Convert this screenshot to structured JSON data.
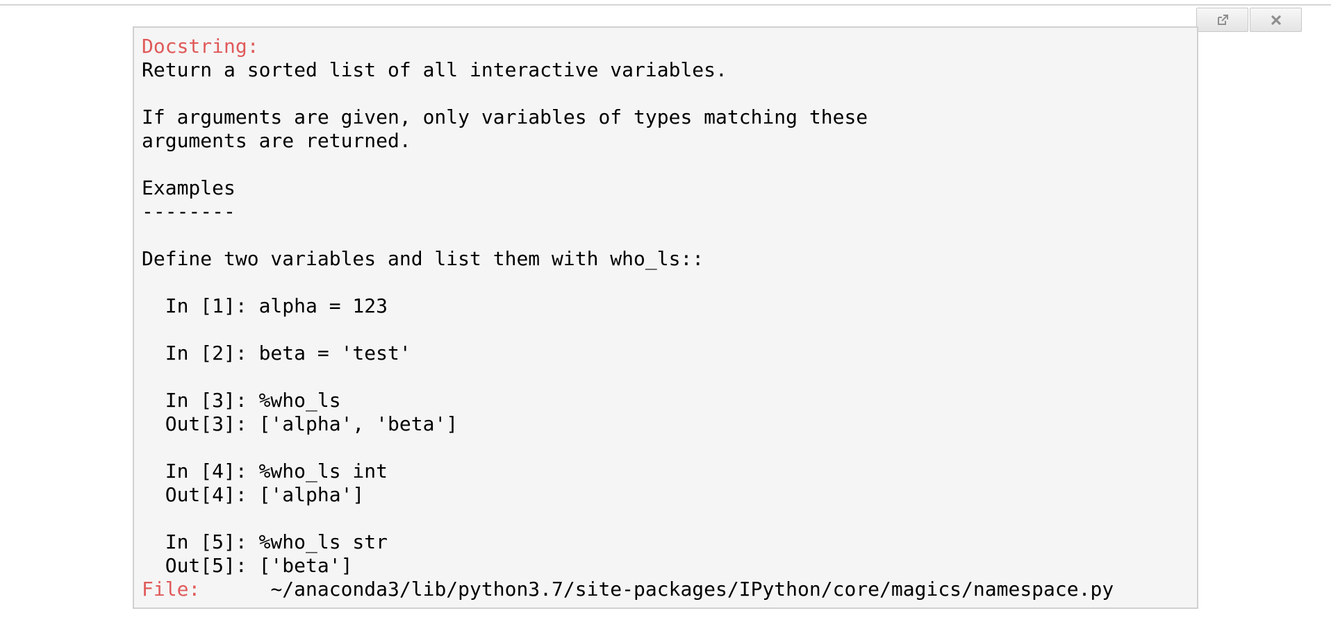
{
  "pager": {
    "docstring_label": "Docstring:",
    "lines": [
      "Return a sorted list of all interactive variables.",
      "",
      "If arguments are given, only variables of types matching these",
      "arguments are returned.",
      "",
      "Examples",
      "--------",
      "",
      "Define two variables and list them with who_ls::",
      "",
      "  In [1]: alpha = 123",
      "",
      "  In [2]: beta = 'test'",
      "",
      "  In [3]: %who_ls",
      "  Out[3]: ['alpha', 'beta']",
      "",
      "  In [4]: %who_ls int",
      "  Out[4]: ['alpha']",
      "",
      "  In [5]: %who_ls str",
      "  Out[5]: ['beta']"
    ],
    "file_label": "File:",
    "file_path": "      ~/anaconda3/lib/python3.7/site-packages/IPython/core/magics/namespace.py"
  },
  "buttons": {
    "open_icon": "external-link-icon",
    "close_icon": "close-icon"
  },
  "colors": {
    "label_red": "#e05a5a",
    "pager_bg": "#f5f5f5"
  }
}
